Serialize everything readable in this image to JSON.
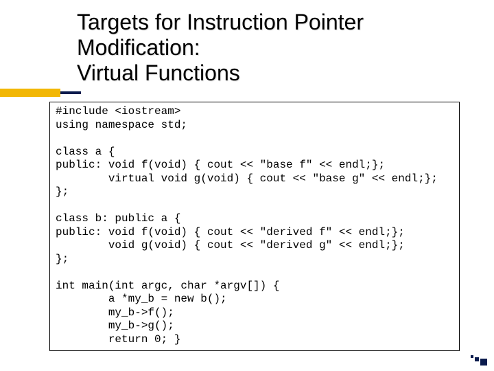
{
  "title": {
    "line1": "Targets for Instruction Pointer",
    "line2": "Modification:",
    "line3": "Virtual Functions"
  },
  "code": {
    "l01": "#include <iostream>",
    "l02": "using namespace std;",
    "l03": "",
    "l04": "class a {",
    "l05": "public: void f(void) { cout << \"base f\" << endl;};",
    "l06": "        virtual void g(void) { cout << \"base g\" << endl;};",
    "l07": "};",
    "l08": "",
    "l09": "class b: public a {",
    "l10": "public: void f(void) { cout << \"derived f\" << endl;};",
    "l11": "        void g(void) { cout << \"derived g\" << endl;};",
    "l12": "};",
    "l13": "",
    "l14": "int main(int argc, char *argv[]) {",
    "l15": "        a *my_b = new b();",
    "l16": "        my_b->f();",
    "l17": "        my_b->g();",
    "l18": "        return 0; }"
  }
}
